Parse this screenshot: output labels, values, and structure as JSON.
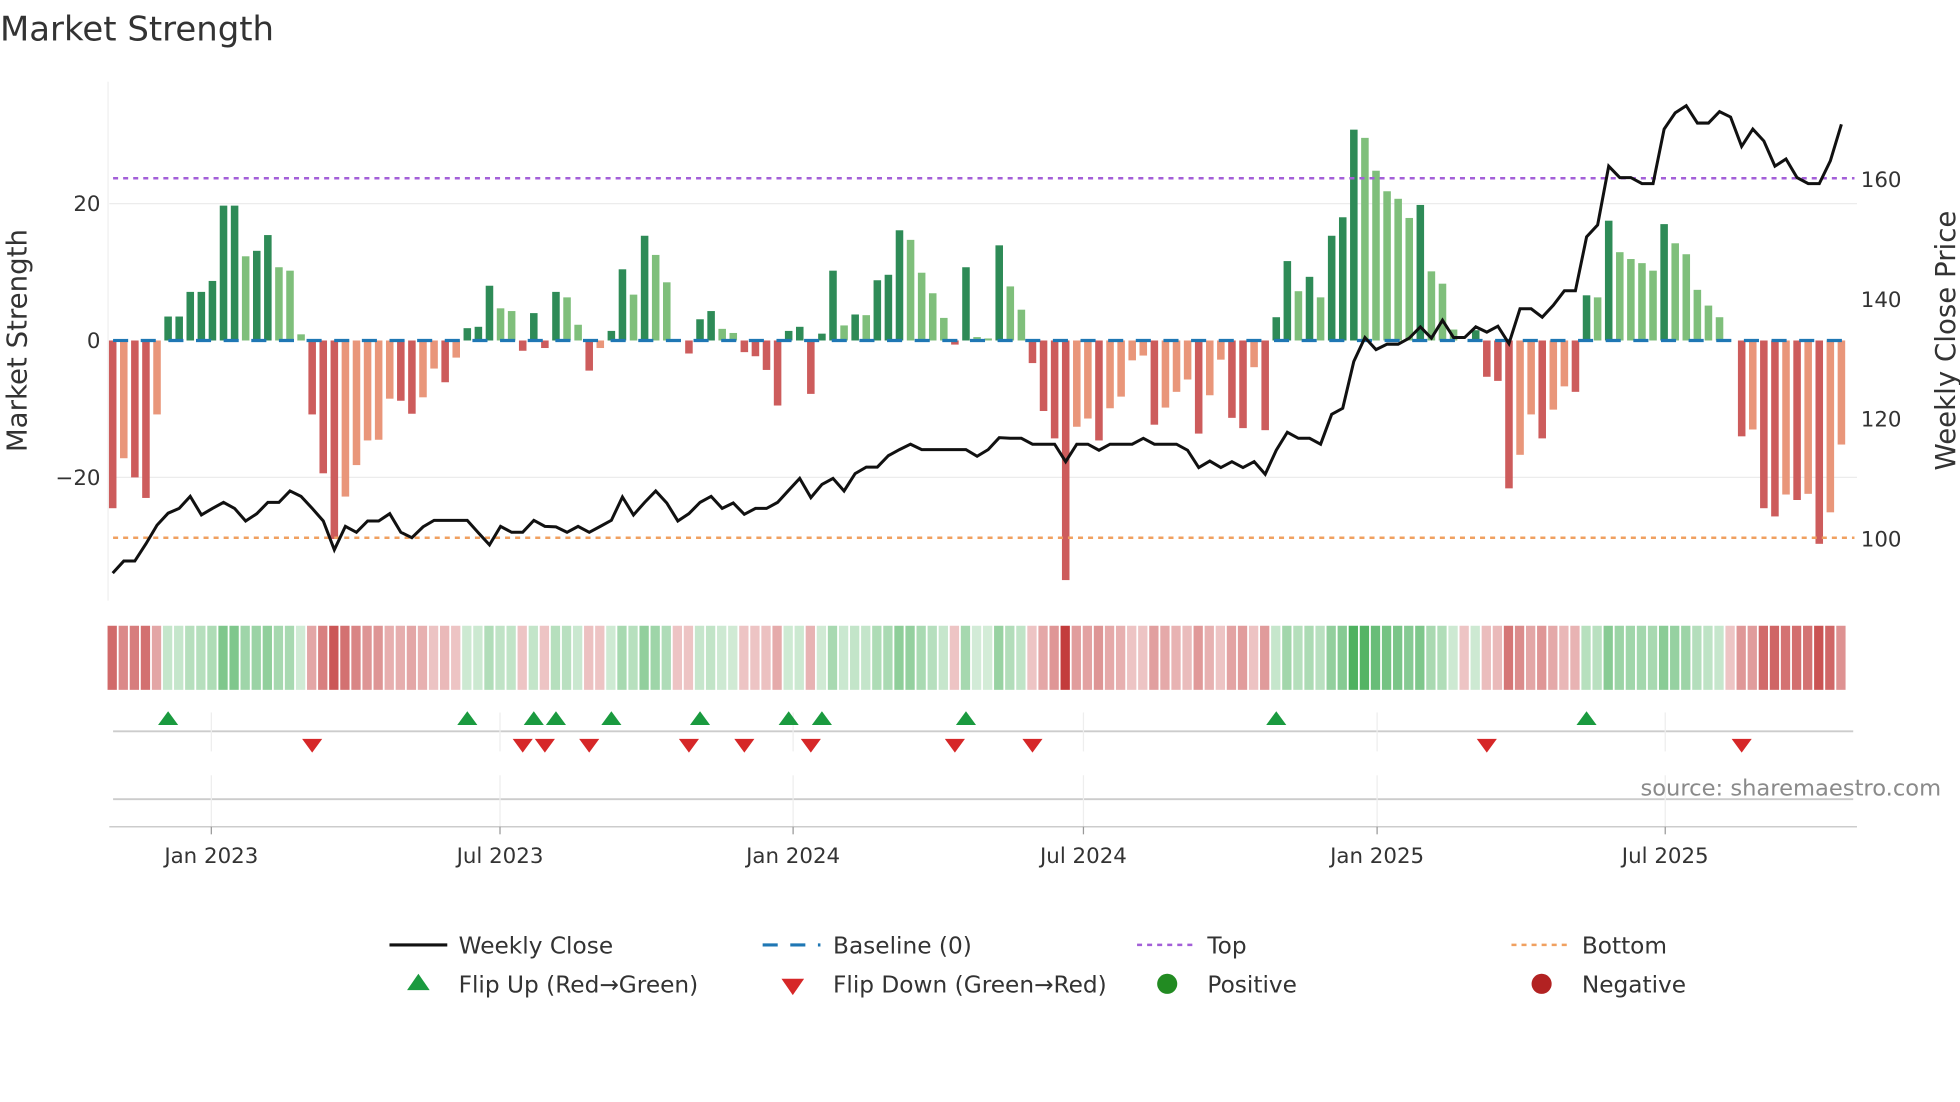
{
  "title": "Market Strength",
  "source": "source: sharemaestro.com",
  "chart_data": {
    "type": "bar",
    "title": "Market Strength",
    "ylabel": "Market Strength",
    "y2label": "Weekly Close Price",
    "ylim": [
      -38,
      37.8
    ],
    "y2lim": [
      89.5,
      176.1
    ],
    "yticks": [
      {
        "v": 20,
        "label": "20"
      },
      {
        "v": 0,
        "label": "0"
      },
      {
        "v": -20,
        "label": "−20"
      }
    ],
    "y2ticks": [
      {
        "v": 100,
        "label": "100"
      },
      {
        "v": 120,
        "label": "120"
      },
      {
        "v": 140,
        "label": "140"
      },
      {
        "v": 160,
        "label": "160"
      }
    ],
    "xticks": [
      {
        "week": 9.9,
        "label": "Jan 2023"
      },
      {
        "week": 35.95,
        "label": "Jul 2023"
      },
      {
        "week": 62.4,
        "label": "Jan 2024"
      },
      {
        "week": 88.6,
        "label": "Jul 2024"
      },
      {
        "week": 115.1,
        "label": "Jan 2025"
      },
      {
        "week": 141.1,
        "label": "Jul 2025"
      }
    ],
    "top_level_price": 160,
    "bottom_level_price": 100,
    "baseline": 0,
    "strength": [
      -24.5,
      -17.2,
      -20,
      -23,
      -10.8,
      3.5,
      3.5,
      7.1,
      7.1,
      8.7,
      19.7,
      19.7,
      12.3,
      13.1,
      15.4,
      10.7,
      10.2,
      0.9,
      -10.8,
      -19.4,
      -29,
      -22.8,
      -18.2,
      -14.6,
      -14.5,
      -8.5,
      -8.8,
      -10.7,
      -8.3,
      -4.1,
      -6.1,
      -2.5,
      1.8,
      2,
      8,
      4.7,
      4.3,
      -1.5,
      4,
      -1.1,
      7.1,
      6.3,
      2.3,
      -4.4,
      -1.1,
      1.4,
      10.4,
      6.7,
      15.3,
      12.5,
      8.5,
      0,
      -1.9,
      3.1,
      4.3,
      1.7,
      1.1,
      -1.7,
      -2.3,
      -4.3,
      -9.5,
      1.4,
      2,
      -7.8,
      1,
      10.2,
      2.2,
      3.8,
      3.7,
      8.8,
      9.6,
      16.1,
      14.7,
      9.9,
      6.9,
      3.3,
      -0.6,
      10.7,
      0.5,
      0.3,
      13.9,
      7.9,
      4.5,
      -3.3,
      -10.3,
      -14.3,
      -35,
      -12.6,
      -11.4,
      -14.6,
      -9.9,
      -8.2,
      -2.9,
      -2.2,
      -12.3,
      -9.8,
      -7.5,
      -5.7,
      -13.6,
      -8,
      -2.8,
      -11.3,
      -12.8,
      -3.9,
      -13.1,
      3.4,
      11.6,
      7.2,
      9.3,
      6.3,
      15.3,
      18,
      30.8,
      29.6,
      24.8,
      21.8,
      20.7,
      17.9,
      19.8,
      10.1,
      8.3,
      1.6,
      0,
      1.5,
      -5.3,
      -5.9,
      -21.6,
      -16.7,
      -10.8,
      -14.3,
      -10.1,
      -6.7,
      -7.5,
      6.6,
      6.3,
      17.5,
      12.9,
      11.9,
      11.3,
      10.2,
      17,
      14.2,
      12.6,
      7.4,
      5.1,
      3.4,
      0,
      -14,
      -13,
      -24.5,
      -25.7,
      -22.5,
      -23.3,
      -22.4,
      -29.7,
      -25.1,
      -15.2
    ],
    "weekly_close": [
      94.1,
      96.1,
      96.1,
      99,
      102.1,
      104.1,
      104.9,
      106.9,
      103.8,
      104.9,
      105.9,
      104.9,
      102.8,
      104,
      105.9,
      105.9,
      107.8,
      106.9,
      104.9,
      102.8,
      98,
      101.9,
      100.9,
      102.8,
      102.8,
      104,
      100.9,
      100,
      101.8,
      102.9,
      102.9,
      102.9,
      102.9,
      100.8,
      98.8,
      101.9,
      100.9,
      100.9,
      102.9,
      101.9,
      101.8,
      100.9,
      101.9,
      100.9,
      101.9,
      102.9,
      106.8,
      103.8,
      105.9,
      107.8,
      105.8,
      102.8,
      104,
      105.9,
      106.9,
      104.9,
      105.8,
      103.9,
      104.9,
      104.9,
      105.9,
      107.9,
      109.9,
      106.7,
      108.9,
      109.9,
      107.8,
      110.7,
      111.8,
      111.8,
      113.7,
      114.7,
      115.6,
      114.7,
      114.7,
      114.7,
      114.7,
      114.7,
      113.6,
      114.7,
      116.7,
      116.6,
      116.6,
      115.6,
      115.6,
      115.6,
      112.7,
      115.6,
      115.6,
      114.6,
      115.6,
      115.6,
      115.6,
      116.6,
      115.6,
      115.6,
      115.6,
      114.6,
      111.7,
      112.8,
      111.7,
      112.7,
      111.7,
      112.7,
      110.6,
      114.6,
      117.6,
      116.6,
      116.6,
      115.6,
      120.6,
      121.6,
      129.4,
      133.4,
      131.4,
      132.3,
      132.3,
      133.3,
      135.2,
      133.3,
      136.3,
      133.4,
      133.4,
      135.2,
      134.3,
      135.3,
      132.4,
      138.2,
      138.2,
      136.8,
      138.8,
      141.2,
      141.2,
      150.2,
      152.2,
      162,
      160.1,
      160.1,
      159.1,
      159.1,
      168.2,
      170.9,
      172.1,
      169.2,
      169.2,
      171.1,
      170.2,
      165.3,
      168.2,
      166.2,
      162,
      163.2,
      160.1,
      159.1,
      159.1,
      162.9,
      169
    ],
    "flip_up_weeks": [
      6,
      33,
      39,
      41,
      46,
      54,
      62,
      65,
      78,
      106,
      134
    ],
    "flip_down_weeks": [
      19,
      38,
      40,
      44,
      53,
      58,
      64,
      77,
      84,
      125,
      148
    ],
    "colors": {
      "pos_rising": "#2e8b57",
      "pos_falling": "#7fbf7b",
      "neg_falling": "#cd5c5c",
      "neg_rising": "#e9967a",
      "baseline": "#1f77b4",
      "top": "#a35fd8",
      "bottom": "#f0a060",
      "price": "#111111",
      "flip_up": "#1a9a3f",
      "flip_down": "#d62728",
      "positive": "#228b22",
      "negative": "#b22222"
    },
    "legend": {
      "placement": "bottom",
      "weekly_close": "Weekly Close",
      "baseline": "Baseline (0)",
      "top": "Top",
      "bottom": "Bottom",
      "flip_up": "Flip Up (Red→Green)",
      "flip_down": "Flip Down (Green→Red)",
      "positive": "Positive",
      "negative": "Negative"
    }
  }
}
